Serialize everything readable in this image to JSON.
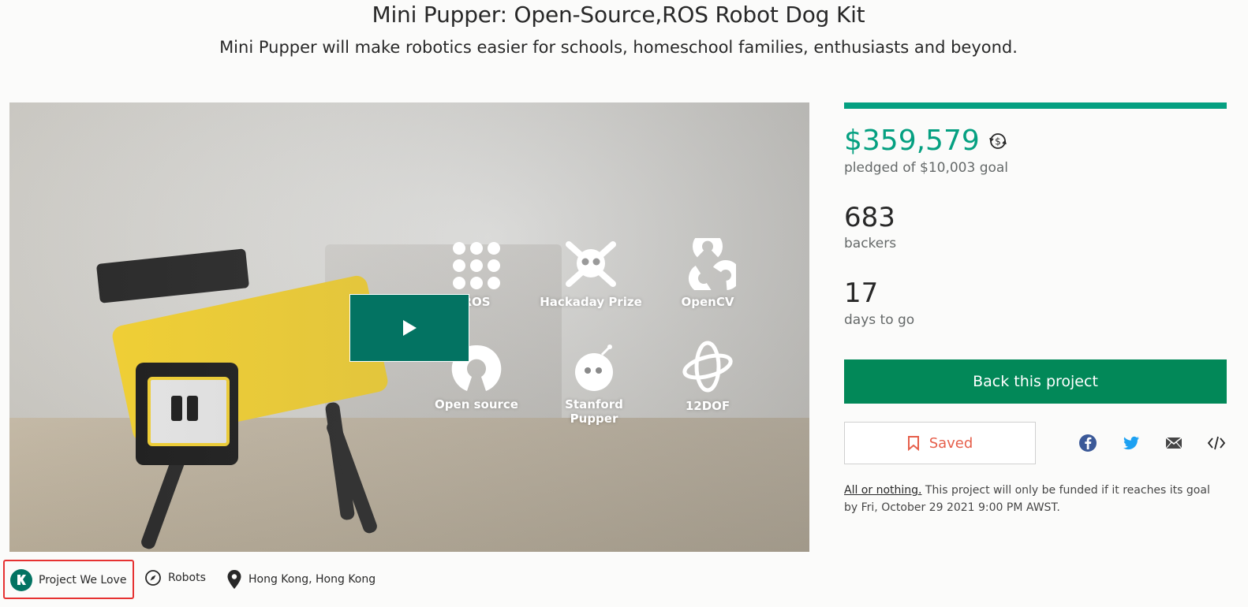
{
  "project": {
    "title": "Mini Pupper: Open-Source,ROS Robot Dog Kit",
    "subtitle": "Mini Pupper will make robotics easier for schools, homeschool families, enthusiasts and beyond."
  },
  "video": {
    "features": [
      {
        "label": "ROS",
        "icon": "ros-dots-icon"
      },
      {
        "label": "Hackaday Prize",
        "icon": "skull-wrenches-icon"
      },
      {
        "label": "OpenCV",
        "icon": "opencv-icon"
      },
      {
        "label": "Open source",
        "icon": "open-source-icon"
      },
      {
        "label": "Stanford Pupper",
        "icon": "pupper-head-icon"
      },
      {
        "label": "12DOF",
        "icon": "rotation-icon"
      }
    ],
    "play_icon": "play-icon"
  },
  "funding": {
    "progress_percent": 100,
    "pledged": "$359,579",
    "pledged_caption": "pledged of $10,003 goal",
    "backers": "683",
    "backers_caption": "backers",
    "days": "17",
    "days_caption": "days to go",
    "back_button": "Back this project",
    "saved_label": "Saved",
    "share_icons": [
      "facebook-icon",
      "twitter-icon",
      "email-icon",
      "embed-icon"
    ],
    "terms_link": "All or nothing.",
    "terms_text": " This project will only be funded if it reaches its goal by Fri, October 29 2021 9:00 PM AWST."
  },
  "tags": {
    "project_we_love": "Project We Love",
    "category": "Robots",
    "location": "Hong Kong, Hong Kong"
  },
  "colors": {
    "accent": "#05a081",
    "button": "#028858",
    "play": "#037362",
    "saved": "#e65f4b",
    "highlight": "#e63232"
  }
}
